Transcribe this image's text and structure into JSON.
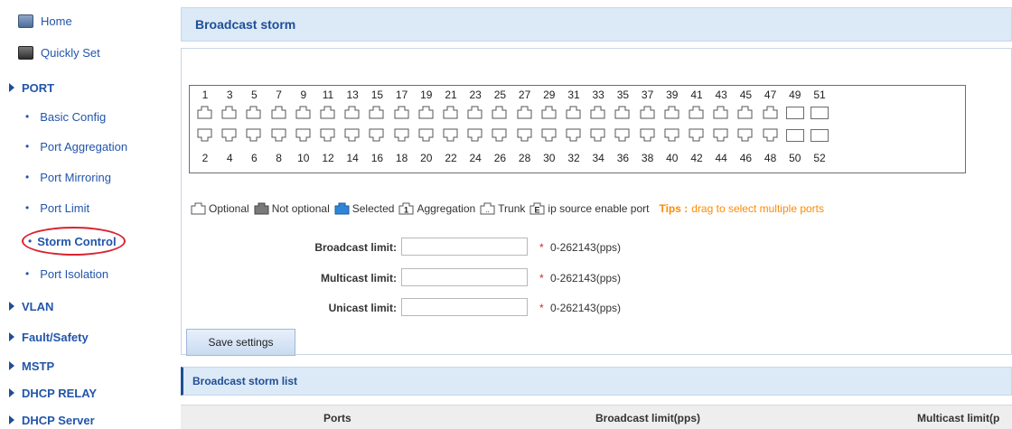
{
  "sidebar": {
    "home": "Home",
    "quickly_set": "Quickly Set",
    "port_section": "PORT",
    "port_items": [
      "Basic Config",
      "Port Aggregation",
      "Port Mirroring",
      "Port Limit",
      "Storm Control",
      "Port Isolation"
    ],
    "active_item": "Storm Control",
    "sections": [
      "VLAN",
      "Fault/Safety",
      "MSTP",
      "DHCP RELAY",
      "DHCP Server"
    ]
  },
  "main": {
    "title": "Broadcast storm",
    "ports": {
      "top_numbers": [
        "1",
        "3",
        "5",
        "7",
        "9",
        "11",
        "13",
        "15",
        "17",
        "19",
        "21",
        "23",
        "25",
        "27",
        "29",
        "31",
        "33",
        "35",
        "37",
        "39",
        "41",
        "43",
        "45",
        "47",
        "49",
        "51"
      ],
      "bottom_numbers": [
        "2",
        "4",
        "6",
        "8",
        "10",
        "12",
        "14",
        "16",
        "18",
        "20",
        "22",
        "24",
        "26",
        "28",
        "30",
        "32",
        "34",
        "36",
        "38",
        "40",
        "42",
        "44",
        "46",
        "48",
        "50",
        "52"
      ]
    },
    "legend": {
      "optional": "Optional",
      "not_optional": "Not optional",
      "selected": "Selected",
      "aggregation": "Aggregation",
      "aggregation_glyph": "1",
      "trunk": "Trunk",
      "trunk_glyph": "..",
      "ipsource": "ip source enable port",
      "ipsource_glyph": "E",
      "tips_label": "Tips :",
      "tips_text": "drag to select multiple ports"
    },
    "form": {
      "broadcast_label": "Broadcast limit:",
      "multicast_label": "Multicast limit:",
      "unicast_label": "Unicast limit:",
      "broadcast_value": "",
      "multicast_value": "",
      "unicast_value": "",
      "required_mark": "*",
      "range_hint": "0-262143(pps)"
    },
    "save_button": "Save settings",
    "list": {
      "title": "Broadcast storm list",
      "columns": [
        "Ports",
        "Broadcast limit(pps)",
        "Multicast limit(p"
      ]
    }
  },
  "colors": {
    "accent": "#1f4e96",
    "title_bar_bg": "#dce9f7",
    "tips": "#ff8a00",
    "highlight_circle": "#d9232d",
    "selected_port": "#2f86d6",
    "not_optional_port": "#7a7a7a"
  },
  "icons": {
    "home": "home-icon",
    "quickly_set": "quickly-set-icon",
    "section_arrow": "arrow-right-icon",
    "port": "port-icon"
  }
}
